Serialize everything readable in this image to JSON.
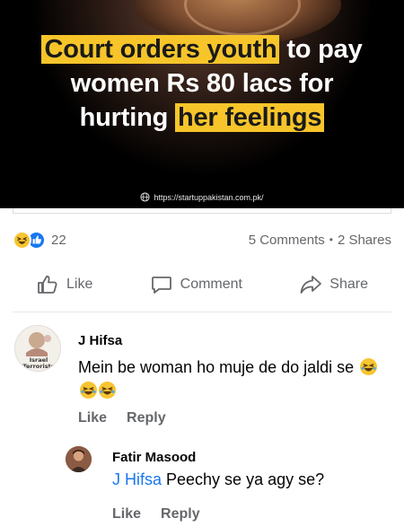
{
  "post": {
    "headline": {
      "part1": "Court orders youth",
      "part2": " to pay",
      "line2": "women Rs 80 lacs for",
      "line3a": "hurting ",
      "line3b": "her feelings"
    },
    "source_url": "https://startuppakistan.com.pk/",
    "reaction_count": "22",
    "comments_count": "5 Comments",
    "shares_count": "2 Shares",
    "separator": "•"
  },
  "actions": {
    "like": "Like",
    "comment": "Comment",
    "share": "Share"
  },
  "comments": [
    {
      "author": "J Hifsa",
      "text": "Mein be woman ho muje de do jaldi se",
      "avatar_caption_1": "Israel",
      "avatar_caption_2": "Terrorists",
      "like_label": "Like",
      "reply_label": "Reply"
    },
    {
      "author": "Fatir Masood",
      "mention": "J Hifsa",
      "text": " Peechy se ya agy se?",
      "like_label": "Like",
      "reply_label": "Reply"
    }
  ],
  "colors": {
    "highlight": "#f7c52a",
    "link_blue": "#1877f2",
    "muted_text": "#65676b"
  }
}
